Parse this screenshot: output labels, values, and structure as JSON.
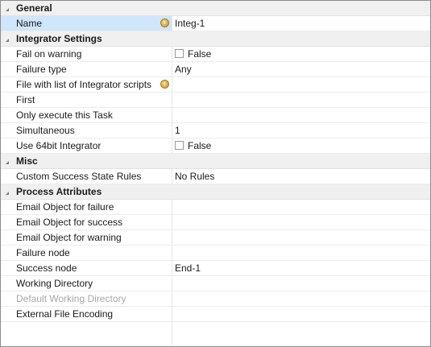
{
  "categories": [
    {
      "label": "General",
      "props": [
        {
          "name": "Name",
          "value": "Integ-1",
          "selected": true,
          "info": true
        }
      ]
    },
    {
      "label": "Integrator Settings",
      "props": [
        {
          "name": "Fail on warning",
          "type": "checkbox",
          "value": "False"
        },
        {
          "name": "Failure type",
          "value": "Any"
        },
        {
          "name": "File with list of Integrator scripts",
          "value": "",
          "info": true
        },
        {
          "name": "First",
          "value": ""
        },
        {
          "name": "Only execute this Task",
          "value": ""
        },
        {
          "name": "Simultaneous",
          "value": "1"
        },
        {
          "name": "Use 64bit Integrator",
          "type": "checkbox",
          "value": "False"
        }
      ]
    },
    {
      "label": "Misc",
      "props": [
        {
          "name": "Custom Success State Rules",
          "value": "No Rules"
        }
      ]
    },
    {
      "label": "Process Attributes",
      "props": [
        {
          "name": "Email Object for failure",
          "value": ""
        },
        {
          "name": "Email Object for success",
          "value": ""
        },
        {
          "name": "Email Object for warning",
          "value": ""
        },
        {
          "name": "Failure node",
          "value": ""
        },
        {
          "name": "Success node",
          "value": "End-1"
        },
        {
          "name": "Working Directory",
          "value": ""
        },
        {
          "name": "Default Working Directory",
          "value": "",
          "disabled": true
        },
        {
          "name": "External File Encoding",
          "value": ""
        }
      ]
    }
  ]
}
